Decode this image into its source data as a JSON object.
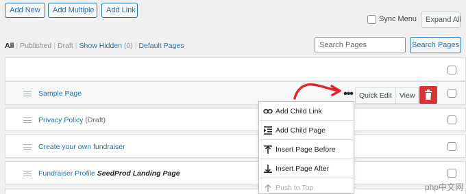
{
  "toolbar": {
    "add_new": "Add New",
    "add_multiple": "Add Multiple",
    "add_link": "Add Link",
    "sync_menu": "Sync Menu",
    "expand_all": "Expand All"
  },
  "filters": {
    "all": "All",
    "published": "Published",
    "draft": "Draft",
    "show_hidden": "Show Hidden",
    "hidden_count": "(0)",
    "default_pages": "Default Pages"
  },
  "search": {
    "placeholder": "Search Pages",
    "button": "Search Pages"
  },
  "rows": [
    {
      "title": "Sample Page",
      "state": "",
      "template": ""
    },
    {
      "title": "Privacy Policy",
      "state": "(Draft)",
      "template": ""
    },
    {
      "title": "Create your own fundraiser",
      "state": "",
      "template": ""
    },
    {
      "title": "Fundraiser Profile",
      "state": "",
      "template": "SeedProd Landing Page"
    }
  ],
  "row_actions": {
    "more_icon": "•••",
    "quick_edit": "Quick Edit",
    "view": "View",
    "trash_icon": "trash-icon"
  },
  "menu": {
    "items": [
      {
        "label": "Add Child Link",
        "icon": "link-icon",
        "disabled": false
      },
      {
        "label": "Add Child Page",
        "icon": "child-page-icon",
        "disabled": false
      },
      {
        "label": "Insert Page Before",
        "icon": "insert-before-icon",
        "disabled": false
      },
      {
        "label": "Insert Page After",
        "icon": "insert-after-icon",
        "disabled": false
      },
      {
        "label": "Push to Top",
        "icon": "push-top-icon",
        "disabled": true
      }
    ]
  },
  "annotation": {
    "arrow_color": "#e0252b"
  },
  "watermark": "php中文网",
  "colors": {
    "accent": "#2271b1",
    "danger": "#d63638",
    "background": "#f0f0f1"
  }
}
